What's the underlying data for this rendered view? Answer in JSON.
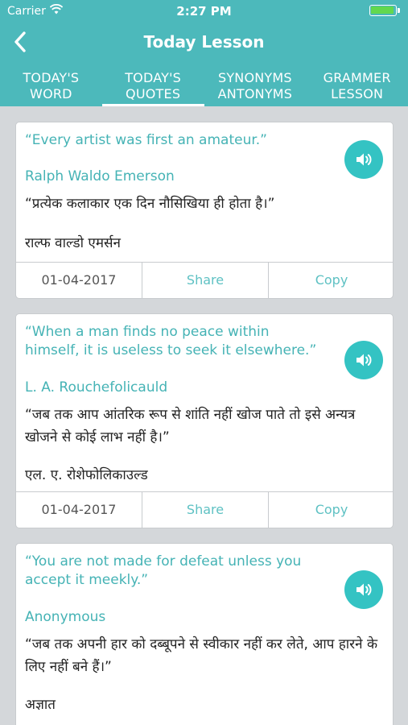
{
  "status": {
    "carrier": "Carrier",
    "time": "2:27 PM"
  },
  "header": {
    "title": "Today Lesson"
  },
  "tabs": [
    {
      "line1": "TODAY'S",
      "line2": "WORD"
    },
    {
      "line1": "TODAY'S",
      "line2": "QUOTES"
    },
    {
      "line1": "SYNONYMS",
      "line2": "ANTONYMS"
    },
    {
      "line1": "GRAMMER",
      "line2": "LESSON"
    }
  ],
  "active_tab": 1,
  "quotes": [
    {
      "quote_en": "“Every artist was first an amateur.”",
      "author_en": "Ralph Waldo Emerson",
      "quote_hi": "“प्रत्येक कलाकार एक दिन नौसिखिया ही होता है।”",
      "author_hi": "राल्फ वाल्डो एमर्सन",
      "date": "01-04-2017",
      "share": "Share",
      "copy": "Copy"
    },
    {
      "quote_en": "“When a man finds no peace within himself, it is useless to seek it elsewhere.”",
      "author_en": "L. A. Rouchefolicauld",
      "quote_hi": "“जब तक आप आंतरिक रूप से शांति नहीं खोज पाते तो इसे अन्यत्र खोजने से कोई लाभ नहीं है।”",
      "author_hi": "एल. ए. रोशेफोलिकाउल्ड",
      "date": "01-04-2017",
      "share": "Share",
      "copy": "Copy"
    },
    {
      "quote_en": "“You are not made for defeat unless you accept it meekly.”",
      "author_en": "Anonymous",
      "quote_hi": "“जब तक अपनी हार को दब्बूपने से स्वीकार नहीं कर लेते, आप हारने के लिए नहीं बने हैं।”",
      "author_hi": "अज्ञात"
    }
  ],
  "colors": {
    "accent": "#4cb9bb",
    "speaker": "#34c3c3",
    "quote_text": "#45b3b5",
    "background": "#d4d7da"
  },
  "icons": {
    "back": "chevron-left-icon",
    "speaker": "speaker-icon",
    "wifi": "wifi-icon",
    "battery": "battery-icon"
  }
}
